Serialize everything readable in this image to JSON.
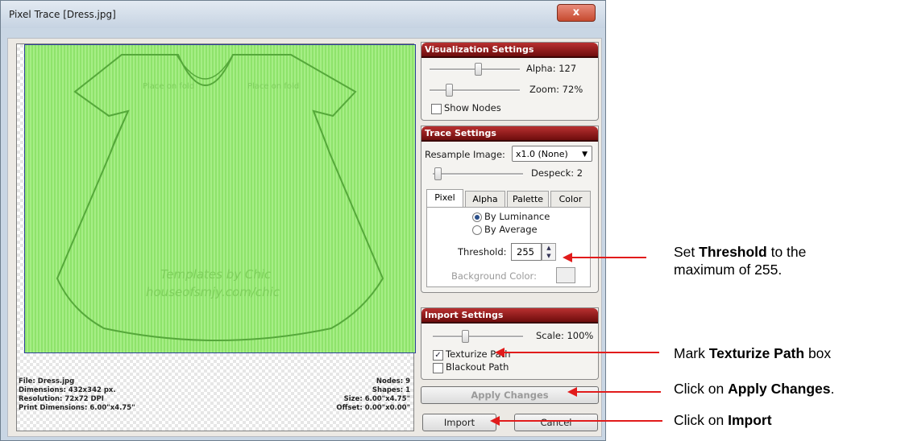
{
  "window": {
    "title": "Pixel Trace [Dress.jpg]",
    "close_glyph": "x"
  },
  "canvas": {
    "watermark_top_left": "Place on fold",
    "watermark_top_right": "Place on fold",
    "watermark_center_1": "Templates by Chic",
    "watermark_center_2": "houseofsmjy.com/chic"
  },
  "info": {
    "file": "File: Dress.jpg",
    "dimensions": "Dimensions: 432x342 px.",
    "resolution": "Resolution: 72x72 DPI",
    "print_dimensions": "Print Dimensions: 6.00\"x4.75\"",
    "nodes": "Nodes: 9",
    "shapes": "Shapes: 1",
    "size": "Size: 6.00\"x4.75\"",
    "offset": "Offset: 0.00\"x0.00\""
  },
  "visualization": {
    "header": "Visualization Settings",
    "alpha_label": "Alpha: 127",
    "alpha_fraction": 0.5,
    "zoom_label": "Zoom: 72%",
    "zoom_fraction": 0.2,
    "show_nodes": "Show Nodes"
  },
  "trace": {
    "header": "Trace Settings",
    "resample_label": "Resample Image:",
    "resample_value": "x1.0 (None)",
    "despeck_label": "Despeck: 2",
    "tabs": [
      "Pixel",
      "Alpha",
      "Palette",
      "Color"
    ],
    "by_luminance": "By Luminance",
    "by_average": "By Average",
    "threshold_label": "Threshold:",
    "threshold_value": "255",
    "background_color": "Background Color:"
  },
  "import_settings": {
    "header": "Import Settings",
    "scale_label": "Scale: 100%",
    "texturize": "Texturize Path",
    "blackout": "Blackout Path"
  },
  "buttons": {
    "apply": "Apply Changes",
    "import": "Import",
    "cancel": "Cancel"
  },
  "annotations": {
    "threshold_pre": "Set ",
    "threshold_bold": "Threshold",
    "threshold_post": " to the",
    "threshold_line2": "maximum of 255.",
    "texturize_pre": "Mark ",
    "texturize_bold": "Texturize Path",
    "texturize_post": " box",
    "apply_pre": "Click on ",
    "apply_bold": "Apply Changes",
    "apply_post": ".",
    "import_pre": "Click on ",
    "import_bold": "Import"
  },
  "colors": {
    "header_red": "#8b1414",
    "arrow_red": "#e11b1b",
    "trace_green": "#8ee36b"
  }
}
